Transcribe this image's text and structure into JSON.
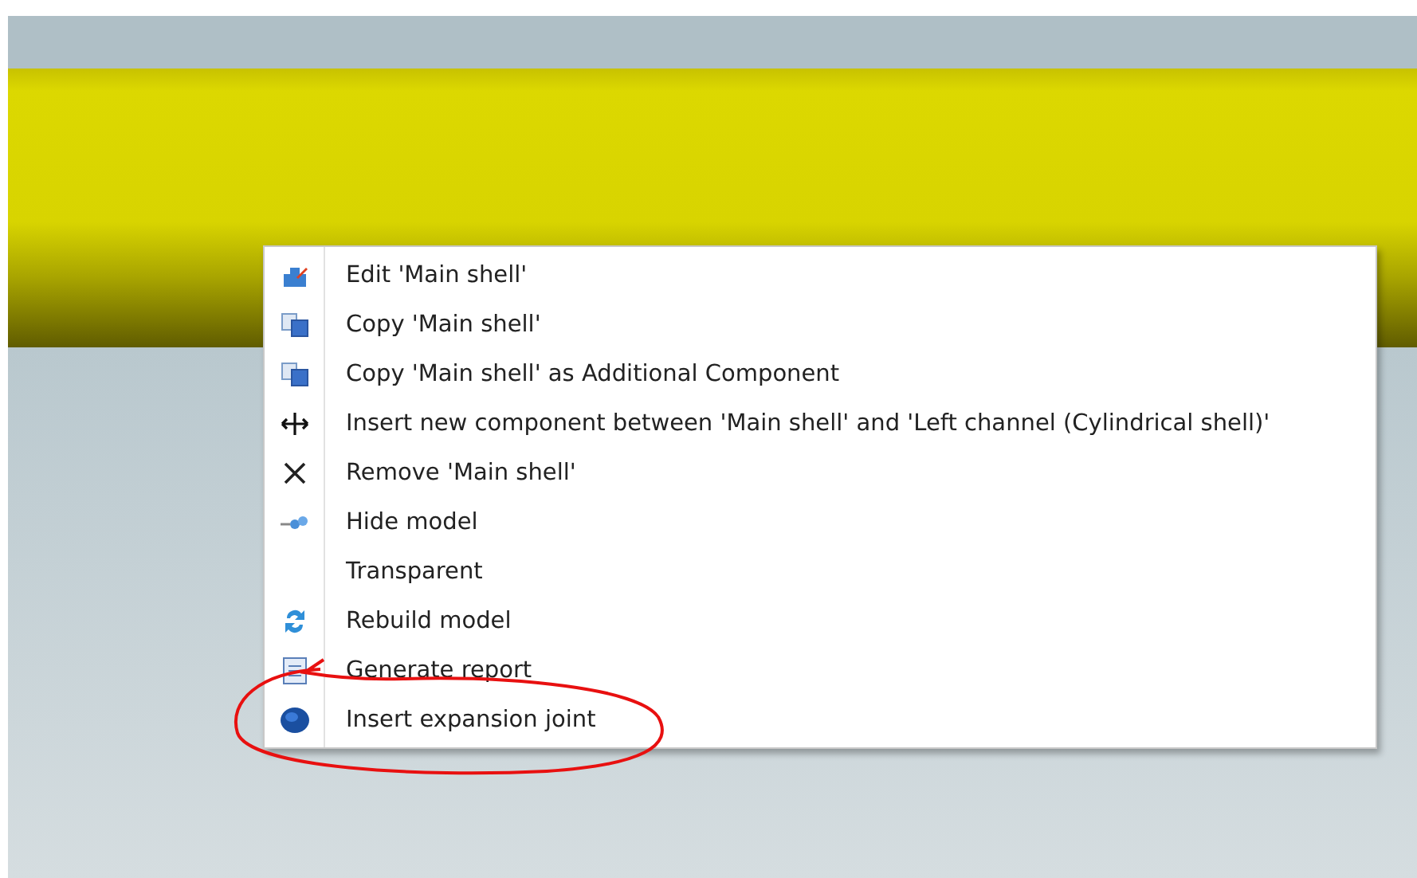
{
  "context_menu": {
    "items": [
      {
        "label": "Edit 'Main shell'",
        "kind": "edit"
      },
      {
        "label": "Copy 'Main shell'",
        "kind": "copy"
      },
      {
        "label": "Copy 'Main shell' as Additional Component",
        "kind": "copy"
      },
      {
        "label": "Insert new component between 'Main shell' and 'Left channel (Cylindrical shell)'",
        "kind": "insert"
      },
      {
        "label": "Remove 'Main shell'",
        "kind": "remove"
      },
      {
        "label": "Hide model",
        "kind": "hide"
      },
      {
        "label": "Transparent",
        "kind": "plain"
      },
      {
        "label": "Rebuild model",
        "kind": "rebuild"
      },
      {
        "label": "Generate report",
        "kind": "report"
      },
      {
        "label": "Insert expansion joint",
        "kind": "joint"
      }
    ]
  }
}
